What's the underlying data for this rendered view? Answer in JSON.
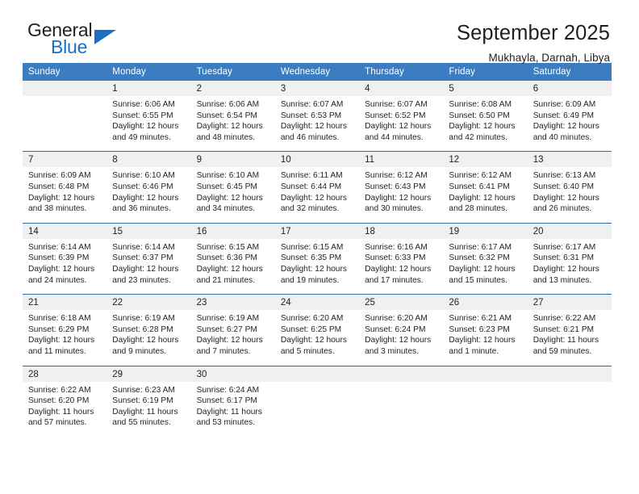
{
  "brand": {
    "name_dark": "General",
    "name_light": "Blue",
    "accent_color": "#1a6fc4"
  },
  "header": {
    "title": "September 2025",
    "subtitle": "Mukhayla, Darnah, Libya"
  },
  "theme": {
    "header_row_bg": "#3b7dc0",
    "week_divider": "#2b6cab",
    "daynum_bg": "#f0f0f0",
    "text": "#231f20"
  },
  "weekday_headers": [
    "Sunday",
    "Monday",
    "Tuesday",
    "Wednesday",
    "Thursday",
    "Friday",
    "Saturday"
  ],
  "weeks": [
    [
      {
        "day": "",
        "sunrise": "",
        "sunset": "",
        "daylight_1": "",
        "daylight_2": ""
      },
      {
        "day": "1",
        "sunrise": "Sunrise: 6:06 AM",
        "sunset": "Sunset: 6:55 PM",
        "daylight_1": "Daylight: 12 hours",
        "daylight_2": "and 49 minutes."
      },
      {
        "day": "2",
        "sunrise": "Sunrise: 6:06 AM",
        "sunset": "Sunset: 6:54 PM",
        "daylight_1": "Daylight: 12 hours",
        "daylight_2": "and 48 minutes."
      },
      {
        "day": "3",
        "sunrise": "Sunrise: 6:07 AM",
        "sunset": "Sunset: 6:53 PM",
        "daylight_1": "Daylight: 12 hours",
        "daylight_2": "and 46 minutes."
      },
      {
        "day": "4",
        "sunrise": "Sunrise: 6:07 AM",
        "sunset": "Sunset: 6:52 PM",
        "daylight_1": "Daylight: 12 hours",
        "daylight_2": "and 44 minutes."
      },
      {
        "day": "5",
        "sunrise": "Sunrise: 6:08 AM",
        "sunset": "Sunset: 6:50 PM",
        "daylight_1": "Daylight: 12 hours",
        "daylight_2": "and 42 minutes."
      },
      {
        "day": "6",
        "sunrise": "Sunrise: 6:09 AM",
        "sunset": "Sunset: 6:49 PM",
        "daylight_1": "Daylight: 12 hours",
        "daylight_2": "and 40 minutes."
      }
    ],
    [
      {
        "day": "7",
        "sunrise": "Sunrise: 6:09 AM",
        "sunset": "Sunset: 6:48 PM",
        "daylight_1": "Daylight: 12 hours",
        "daylight_2": "and 38 minutes."
      },
      {
        "day": "8",
        "sunrise": "Sunrise: 6:10 AM",
        "sunset": "Sunset: 6:46 PM",
        "daylight_1": "Daylight: 12 hours",
        "daylight_2": "and 36 minutes."
      },
      {
        "day": "9",
        "sunrise": "Sunrise: 6:10 AM",
        "sunset": "Sunset: 6:45 PM",
        "daylight_1": "Daylight: 12 hours",
        "daylight_2": "and 34 minutes."
      },
      {
        "day": "10",
        "sunrise": "Sunrise: 6:11 AM",
        "sunset": "Sunset: 6:44 PM",
        "daylight_1": "Daylight: 12 hours",
        "daylight_2": "and 32 minutes."
      },
      {
        "day": "11",
        "sunrise": "Sunrise: 6:12 AM",
        "sunset": "Sunset: 6:43 PM",
        "daylight_1": "Daylight: 12 hours",
        "daylight_2": "and 30 minutes."
      },
      {
        "day": "12",
        "sunrise": "Sunrise: 6:12 AM",
        "sunset": "Sunset: 6:41 PM",
        "daylight_1": "Daylight: 12 hours",
        "daylight_2": "and 28 minutes."
      },
      {
        "day": "13",
        "sunrise": "Sunrise: 6:13 AM",
        "sunset": "Sunset: 6:40 PM",
        "daylight_1": "Daylight: 12 hours",
        "daylight_2": "and 26 minutes."
      }
    ],
    [
      {
        "day": "14",
        "sunrise": "Sunrise: 6:14 AM",
        "sunset": "Sunset: 6:39 PM",
        "daylight_1": "Daylight: 12 hours",
        "daylight_2": "and 24 minutes."
      },
      {
        "day": "15",
        "sunrise": "Sunrise: 6:14 AM",
        "sunset": "Sunset: 6:37 PM",
        "daylight_1": "Daylight: 12 hours",
        "daylight_2": "and 23 minutes."
      },
      {
        "day": "16",
        "sunrise": "Sunrise: 6:15 AM",
        "sunset": "Sunset: 6:36 PM",
        "daylight_1": "Daylight: 12 hours",
        "daylight_2": "and 21 minutes."
      },
      {
        "day": "17",
        "sunrise": "Sunrise: 6:15 AM",
        "sunset": "Sunset: 6:35 PM",
        "daylight_1": "Daylight: 12 hours",
        "daylight_2": "and 19 minutes."
      },
      {
        "day": "18",
        "sunrise": "Sunrise: 6:16 AM",
        "sunset": "Sunset: 6:33 PM",
        "daylight_1": "Daylight: 12 hours",
        "daylight_2": "and 17 minutes."
      },
      {
        "day": "19",
        "sunrise": "Sunrise: 6:17 AM",
        "sunset": "Sunset: 6:32 PM",
        "daylight_1": "Daylight: 12 hours",
        "daylight_2": "and 15 minutes."
      },
      {
        "day": "20",
        "sunrise": "Sunrise: 6:17 AM",
        "sunset": "Sunset: 6:31 PM",
        "daylight_1": "Daylight: 12 hours",
        "daylight_2": "and 13 minutes."
      }
    ],
    [
      {
        "day": "21",
        "sunrise": "Sunrise: 6:18 AM",
        "sunset": "Sunset: 6:29 PM",
        "daylight_1": "Daylight: 12 hours",
        "daylight_2": "and 11 minutes."
      },
      {
        "day": "22",
        "sunrise": "Sunrise: 6:19 AM",
        "sunset": "Sunset: 6:28 PM",
        "daylight_1": "Daylight: 12 hours",
        "daylight_2": "and 9 minutes."
      },
      {
        "day": "23",
        "sunrise": "Sunrise: 6:19 AM",
        "sunset": "Sunset: 6:27 PM",
        "daylight_1": "Daylight: 12 hours",
        "daylight_2": "and 7 minutes."
      },
      {
        "day": "24",
        "sunrise": "Sunrise: 6:20 AM",
        "sunset": "Sunset: 6:25 PM",
        "daylight_1": "Daylight: 12 hours",
        "daylight_2": "and 5 minutes."
      },
      {
        "day": "25",
        "sunrise": "Sunrise: 6:20 AM",
        "sunset": "Sunset: 6:24 PM",
        "daylight_1": "Daylight: 12 hours",
        "daylight_2": "and 3 minutes."
      },
      {
        "day": "26",
        "sunrise": "Sunrise: 6:21 AM",
        "sunset": "Sunset: 6:23 PM",
        "daylight_1": "Daylight: 12 hours",
        "daylight_2": "and 1 minute."
      },
      {
        "day": "27",
        "sunrise": "Sunrise: 6:22 AM",
        "sunset": "Sunset: 6:21 PM",
        "daylight_1": "Daylight: 11 hours",
        "daylight_2": "and 59 minutes."
      }
    ],
    [
      {
        "day": "28",
        "sunrise": "Sunrise: 6:22 AM",
        "sunset": "Sunset: 6:20 PM",
        "daylight_1": "Daylight: 11 hours",
        "daylight_2": "and 57 minutes."
      },
      {
        "day": "29",
        "sunrise": "Sunrise: 6:23 AM",
        "sunset": "Sunset: 6:19 PM",
        "daylight_1": "Daylight: 11 hours",
        "daylight_2": "and 55 minutes."
      },
      {
        "day": "30",
        "sunrise": "Sunrise: 6:24 AM",
        "sunset": "Sunset: 6:17 PM",
        "daylight_1": "Daylight: 11 hours",
        "daylight_2": "and 53 minutes."
      },
      {
        "day": "",
        "sunrise": "",
        "sunset": "",
        "daylight_1": "",
        "daylight_2": ""
      },
      {
        "day": "",
        "sunrise": "",
        "sunset": "",
        "daylight_1": "",
        "daylight_2": ""
      },
      {
        "day": "",
        "sunrise": "",
        "sunset": "",
        "daylight_1": "",
        "daylight_2": ""
      },
      {
        "day": "",
        "sunrise": "",
        "sunset": "",
        "daylight_1": "",
        "daylight_2": ""
      }
    ]
  ]
}
